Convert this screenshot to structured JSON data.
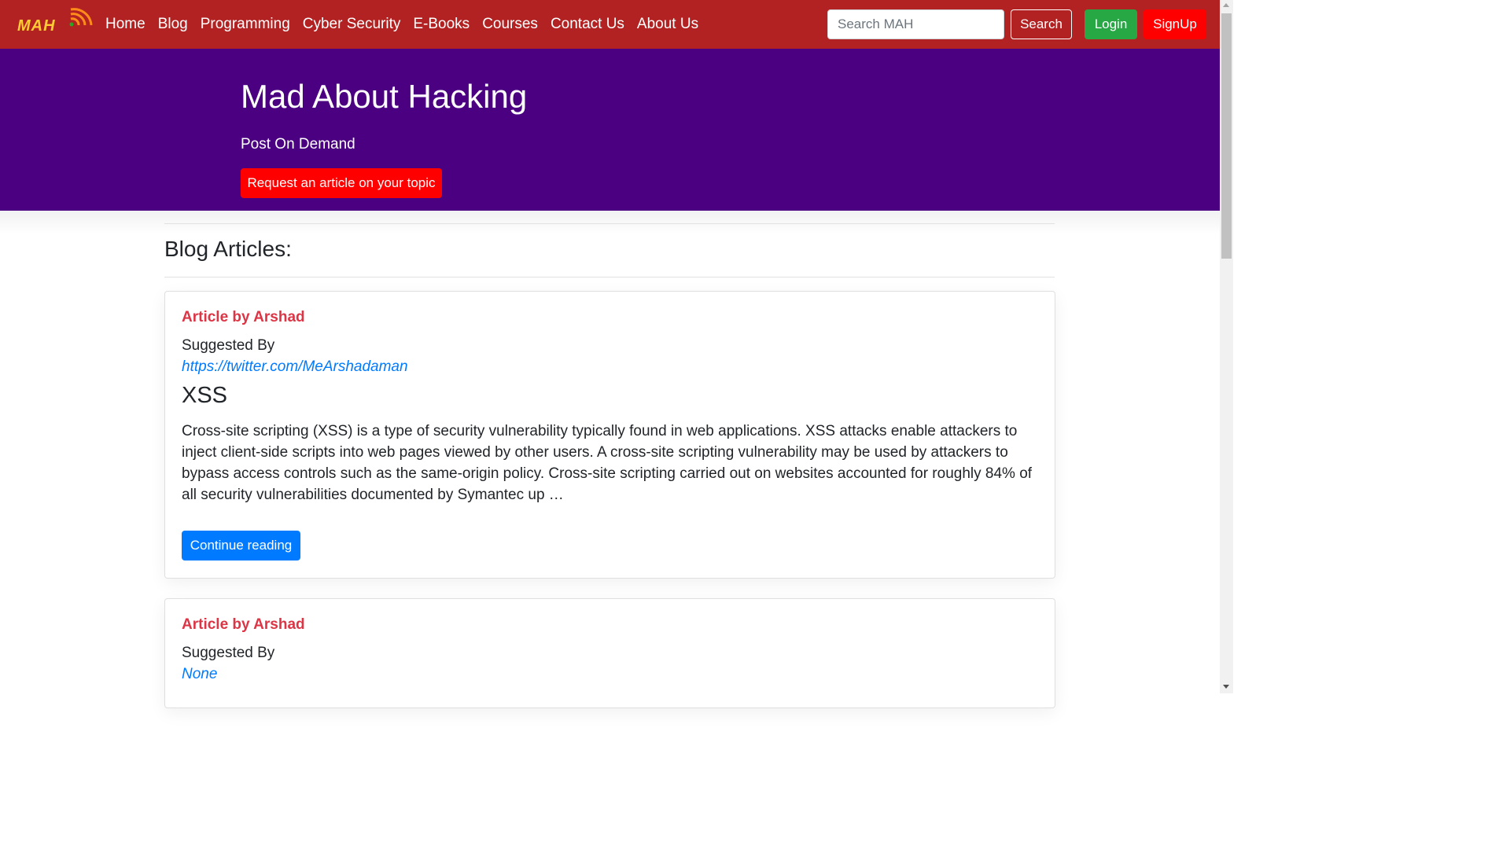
{
  "navbar": {
    "brand": "MAH",
    "links": [
      "Home",
      "Blog",
      "Programming",
      "Cyber Security",
      "E-Books",
      "Courses",
      "Contact Us",
      "About Us"
    ],
    "search_placeholder": "Search MAH",
    "search_label": "Search",
    "login_label": "Login",
    "signup_label": "SignUp"
  },
  "hero": {
    "title": "Mad About Hacking",
    "subtitle": "Post On Demand",
    "button_label": "Request an article on your topic"
  },
  "main": {
    "section_title": "Blog Articles:",
    "articles": [
      {
        "author": "Article by Arshad",
        "suggested_label": "Suggested By",
        "suggested_link": "https://twitter.com/MeArshadaman",
        "title": "XSS",
        "excerpt": "Cross-site scripting (XSS) is a type of security vulnerability typically found in web applications. XSS attacks enable attackers to inject client-side scripts into web pages viewed by other users. A cross-site scripting vulnerability may be used by attackers to bypass access controls such as the same-origin policy. Cross-site scripting carried out on websites accounted for roughly 84% of all security vulnerabilities documented by Symantec up …",
        "button_label": "Continue reading"
      },
      {
        "author": "Article by Arshad",
        "suggested_label": "Suggested By",
        "suggested_link": "None"
      }
    ]
  },
  "colors": {
    "navbar_bg": "#b22222",
    "hero_bg": "#4b0082",
    "author_red": "#dc3545",
    "link_blue": "#007bff",
    "login_green": "#28a745",
    "signup_red": "#ff0000"
  },
  "icons": {
    "brand_icon": "wifi-signal-icon"
  }
}
